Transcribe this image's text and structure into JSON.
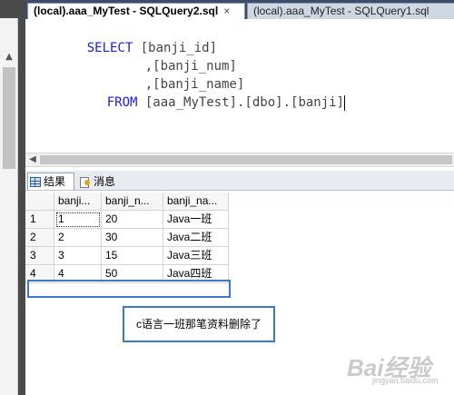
{
  "tabs": [
    {
      "label": "(local).aaa_MyTest - SQLQuery2.sql",
      "close": "×",
      "active": true
    },
    {
      "label": "(local).aaa_MyTest - SQLQuery1.sql",
      "active": false
    }
  ],
  "editor": {
    "lines": [
      {
        "kw": "SELECT",
        "text": " [banji_id]"
      },
      {
        "kw": "",
        "text": ",[banji_num]"
      },
      {
        "kw": "",
        "text": ",[banji_name]"
      },
      {
        "kw": "FROM",
        "text": " [aaa_MyTest].[dbo].[banji]"
      }
    ]
  },
  "icons": {
    "scroll_up": "▲",
    "scroll_left": "◀",
    "results_icon": "grid-icon",
    "messages_icon": "message-icon"
  },
  "results_tabs": {
    "results_label": "结果",
    "messages_label": "消息"
  },
  "grid": {
    "columns": [
      "banji...",
      "banji_n...",
      "banji_na..."
    ],
    "rows": [
      {
        "num": "1",
        "cells": [
          "1",
          "20",
          "Java一班"
        ]
      },
      {
        "num": "2",
        "cells": [
          "2",
          "30",
          "Java二班"
        ]
      },
      {
        "num": "3",
        "cells": [
          "3",
          "15",
          "Java三班"
        ]
      },
      {
        "num": "4",
        "cells": [
          "4",
          "50",
          "Java四班"
        ]
      }
    ]
  },
  "annotation": {
    "text": "c语言一班那笔资料删除了"
  },
  "watermark": {
    "text": "Bai经验",
    "sub": "jingyan.baidu.com"
  },
  "colors": {
    "tabbar": "#3a4d6b",
    "keyword": "#1a1ae6",
    "annotation_border": "#3a78d4"
  }
}
